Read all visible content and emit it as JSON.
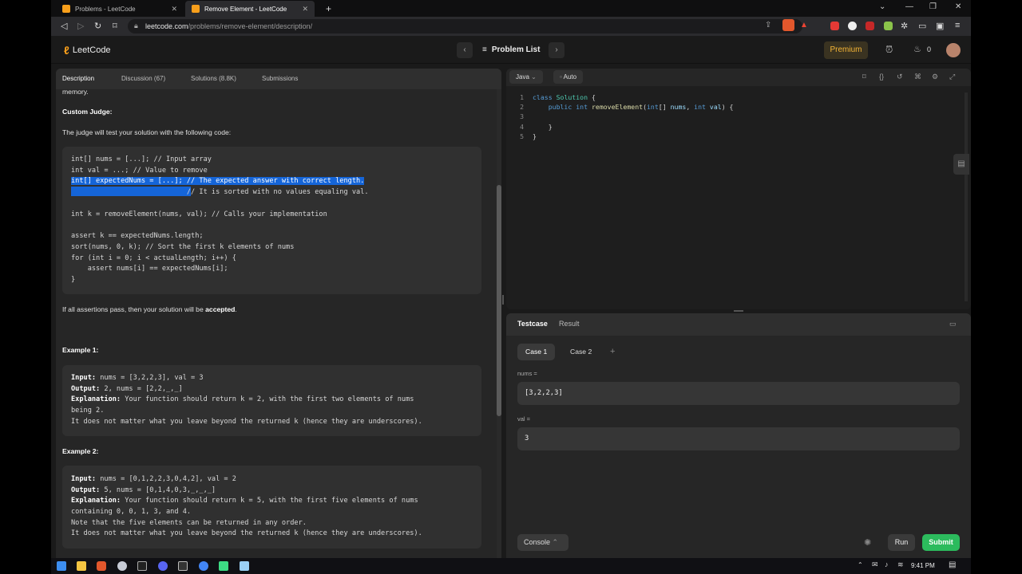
{
  "browser": {
    "tabs": [
      {
        "title": "Problems - LeetCode",
        "active": false
      },
      {
        "title": "Remove Element - LeetCode",
        "active": true
      }
    ],
    "new_tab": "+",
    "url_host": "leetcode.com",
    "url_path": "/problems/remove-element/description/"
  },
  "header": {
    "logo_text": "LeetCode",
    "problem_list": "Problem List",
    "premium": "Premium",
    "streak_count": "0"
  },
  "left_tabs": [
    "Description",
    "Discussion (67)",
    "Solutions (8.8K)",
    "Submissions"
  ],
  "description": {
    "top_fragment": "memory.",
    "custom_judge_title": "Custom Judge:",
    "judge_intro": "The judge will test your solution with the following code:",
    "judge_code": [
      "int[] nums = [...]; // Input array",
      "int val = ...; // Value to remove",
      "int[] expectedNums = [...]; // The expected answer with correct length.",
      "                            // It is sorted with no values equaling val.",
      "",
      "int k = removeElement(nums, val); // Calls your implementation",
      "",
      "assert k == expectedNums.length;",
      "sort(nums, 0, k); // Sort the first k elements of nums",
      "for (int i = 0; i < actualLength; i++) {",
      "    assert nums[i] == expectedNums[i];",
      "}"
    ],
    "assert_pre": "If all assertions pass, then your solution will be ",
    "assert_bold": "accepted",
    "assert_post": ".",
    "example1_title": "Example 1:",
    "example1": {
      "input_label": "Input:",
      "input": " nums = [3,2,2,3], val = 3",
      "output_label": "Output:",
      "output": " 2, nums = [2,2,_,_]",
      "expl_label": "Explanation:",
      "expl1": " Your function should return k = 2, with the first two elements of nums",
      "expl2": "being 2.",
      "expl3": "It does not matter what you leave beyond the returned k (hence they are underscores)."
    },
    "example2_title": "Example 2:",
    "example2": {
      "input_label": "Input:",
      "input": " nums = [0,1,2,2,3,0,4,2], val = 2",
      "output_label": "Output:",
      "output": " 5, nums = [0,1,4,0,3,_,_,_]",
      "expl_label": "Explanation:",
      "expl1": " Your function should return k = 5, with the first five elements of nums",
      "expl2": "containing 0, 0, 1, 3, and 4.",
      "expl3": "Note that the five elements can be returned in any order.",
      "expl4": "It does not matter what you leave beyond the returned k (hence they are underscores)."
    }
  },
  "editor": {
    "language": "Java",
    "mode": "Auto",
    "line_numbers": [
      "1",
      "2",
      "3",
      "4",
      "5"
    ]
  },
  "testcase": {
    "tabs": [
      "Testcase",
      "Result"
    ],
    "cases": [
      "Case 1",
      "Case 2"
    ],
    "add_case": "+",
    "nums_label": "nums =",
    "nums_value": "[3,2,2,3]",
    "val_label": "val =",
    "val_value": "3",
    "console": "Console",
    "run": "Run",
    "submit": "Submit"
  },
  "taskbar": {
    "time": "9:41 PM"
  },
  "colors": {
    "accent_green": "#2cbb5d",
    "premium_gold": "#f5b536",
    "selection_blue": "#1565d8"
  }
}
